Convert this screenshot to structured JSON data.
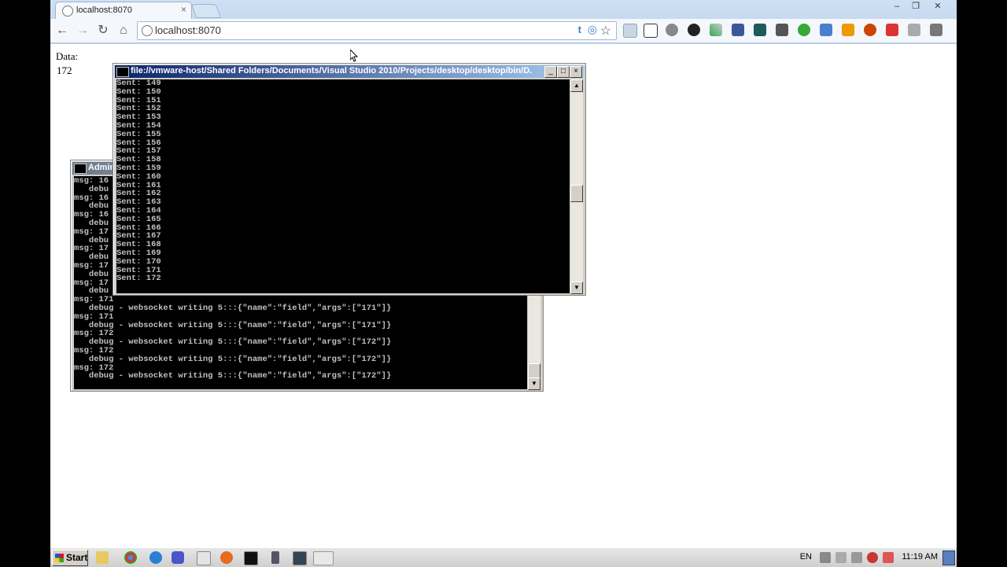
{
  "browser": {
    "tab_title": "localhost:8070",
    "tab_close": "×",
    "url": "localhost:8070",
    "window_controls": [
      "–",
      "❐",
      "✕"
    ]
  },
  "page": {
    "label": "Data:",
    "value": "172"
  },
  "console_front": {
    "title": "file://vmware-host/Shared Folders/Documents/Visual Studio 2010/Projects/desktop/desktop/bin/D...",
    "lines": [
      "Sent: 149",
      "Sent: 150",
      "Sent: 151",
      "Sent: 152",
      "Sent: 153",
      "Sent: 154",
      "Sent: 155",
      "Sent: 156",
      "Sent: 157",
      "Sent: 158",
      "Sent: 159",
      "Sent: 160",
      "Sent: 161",
      "Sent: 162",
      "Sent: 163",
      "Sent: 164",
      "Sent: 165",
      "Sent: 166",
      "Sent: 167",
      "Sent: 168",
      "Sent: 169",
      "Sent: 170",
      "Sent: 171",
      "Sent: 172"
    ],
    "buttons": [
      "_",
      "□",
      "×"
    ]
  },
  "console_back": {
    "title": "Admin",
    "lines_visible_left": [
      "msg: 16",
      "   debu",
      "msg: 16",
      "   debu",
      "msg: 16",
      "   debu",
      "msg: 17",
      "   debu",
      "msg: 17",
      "   debu",
      "msg: 17",
      "   debu",
      "msg: 17",
      "   debu"
    ],
    "lines_full": [
      "msg: 171",
      "   debug - websocket writing 5:::{\"name\":\"field\",\"args\":[\"171\"]}",
      "msg: 171",
      "   debug - websocket writing 5:::{\"name\":\"field\",\"args\":[\"171\"]}",
      "msg: 172",
      "   debug - websocket writing 5:::{\"name\":\"field\",\"args\":[\"172\"]}",
      "msg: 172",
      "   debug - websocket writing 5:::{\"name\":\"field\",\"args\":[\"172\"]}",
      "msg: 172",
      "   debug - websocket writing 5:::{\"name\":\"field\",\"args\":[\"172\"]}"
    ]
  },
  "taskbar": {
    "start_label": "Start",
    "language": "EN",
    "clock": "11:19 AM"
  },
  "colors": {
    "titlebar_active": "#0a246a",
    "console_bg": "#000000",
    "console_text": "#c0c0c0"
  }
}
